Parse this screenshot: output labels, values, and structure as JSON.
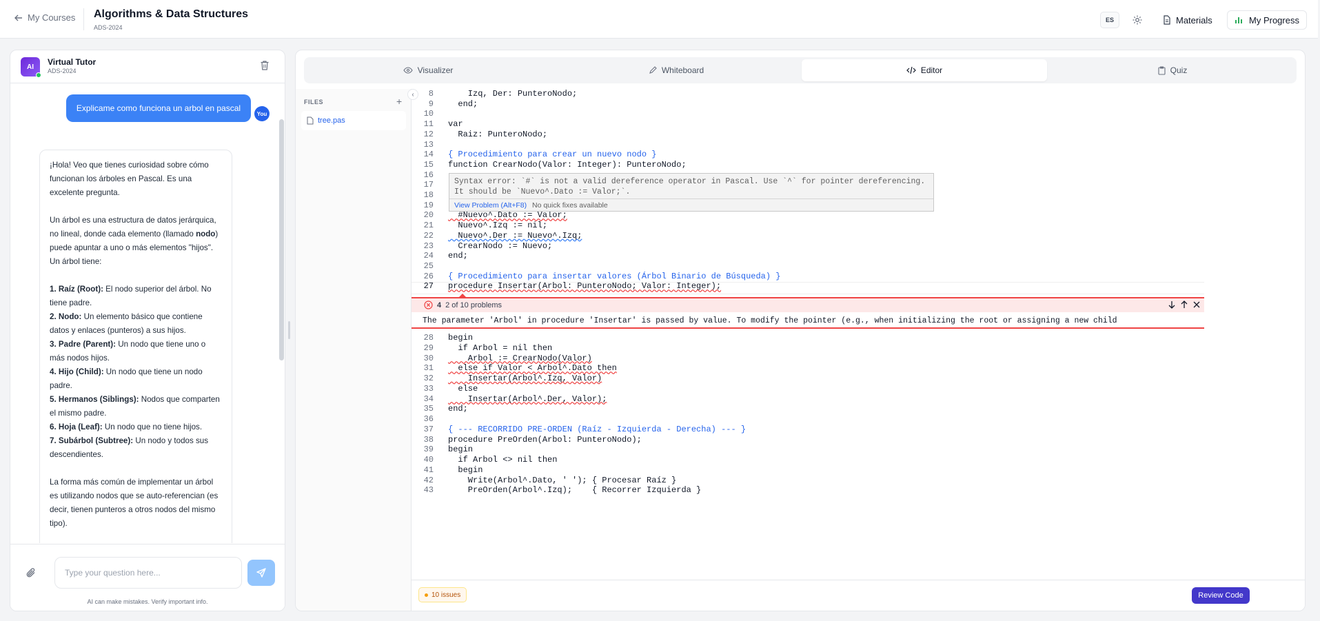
{
  "header": {
    "back_label": "My Courses",
    "title": "Algorithms & Data Structures",
    "code": "ADS-2024",
    "lang": "ES",
    "materials": "Materials",
    "progress": "My Progress"
  },
  "chat": {
    "tutor_name": "Virtual Tutor",
    "tutor_code": "ADS-2024",
    "avatar": "AI",
    "you": "You",
    "user_message": "Explicame como funciona un arbol en pascal",
    "input_placeholder": "Type your question here...",
    "disclaimer": "AI can make mistakes. Verify important info.",
    "ai_response": {
      "p1": "¡Hola! Veo que tienes curiosidad sobre cómo funcionan los árboles en Pascal. Es una excelente pregunta.",
      "p2a": "Un árbol es una estructura de datos jerárquica, no lineal, donde cada elemento (llamado ",
      "p2b": "nodo",
      "p2c": ") puede apuntar a uno o más elementos \"hijos\". Un árbol tiene:",
      "items": [
        {
          "term": "1. Raíz (Root):",
          "desc": " El nodo superior del árbol. No tiene padre."
        },
        {
          "term": "2. Nodo:",
          "desc": " Un elemento básico que contiene datos y enlaces (punteros) a sus hijos."
        },
        {
          "term": "3. Padre (Parent):",
          "desc": " Un nodo que tiene uno o más nodos hijos."
        },
        {
          "term": "4. Hijo (Child):",
          "desc": " Un nodo que tiene un nodo padre."
        },
        {
          "term": "5. Hermanos (Siblings):",
          "desc": " Nodos que comparten el mismo padre."
        },
        {
          "term": "6. Hoja (Leaf):",
          "desc": " Un nodo que no tiene hijos."
        },
        {
          "term": "7. Subárbol (Subtree):",
          "desc": " Un nodo y todos sus descendientes."
        }
      ],
      "p3": "La forma más común de implementar un árbol es utilizando nodos que se auto-referencian (es decir, tienen punteros a otros nodos del mismo tipo)."
    }
  },
  "tabs": [
    {
      "label": "Visualizer",
      "icon": "eye-icon"
    },
    {
      "label": "Whiteboard",
      "icon": "pen-icon"
    },
    {
      "label": "Editor",
      "icon": "code-icon"
    },
    {
      "label": "Quiz",
      "icon": "clipboard-icon"
    }
  ],
  "files": {
    "header": "FILES",
    "add": "+",
    "items": [
      "tree.pas"
    ]
  },
  "editor": {
    "lines": [
      {
        "n": "8",
        "t": "    Izq, Der: PunteroNodo;"
      },
      {
        "n": "9",
        "t": "  end;"
      },
      {
        "n": "10",
        "t": ""
      },
      {
        "n": "11",
        "t": "var"
      },
      {
        "n": "12",
        "t": "  Raiz: PunteroNodo;"
      },
      {
        "n": "13",
        "t": ""
      },
      {
        "n": "14",
        "t": "{ Procedimiento para crear un nuevo nodo }"
      },
      {
        "n": "15",
        "t": "function CrearNodo(Valor: Integer): PunteroNodo;"
      },
      {
        "n": "16",
        "t": ""
      },
      {
        "n": "17",
        "t": ""
      },
      {
        "n": "18",
        "t": ""
      },
      {
        "n": "19",
        "t": ""
      },
      {
        "n": "20",
        "t": "  #Nuevo^.Dato := Valor;"
      },
      {
        "n": "21",
        "t": "  Nuevo^.Izq := nil;"
      },
      {
        "n": "22",
        "t": "  Nuevo^.Der := Nuevo^.Izq;"
      },
      {
        "n": "23",
        "t": "  CrearNodo := Nuevo;"
      },
      {
        "n": "24",
        "t": "end;"
      },
      {
        "n": "25",
        "t": ""
      },
      {
        "n": "26",
        "t": "{ Procedimiento para insertar valores (Árbol Binario de Búsqueda) }"
      },
      {
        "n": "27",
        "t": "procedure Insertar(Arbol: PunteroNodo; Valor: Integer);"
      }
    ],
    "lines_after": [
      {
        "n": "28",
        "t": "begin"
      },
      {
        "n": "29",
        "t": "  if Arbol = nil then"
      },
      {
        "n": "30",
        "t": "    Arbol := CrearNodo(Valor)"
      },
      {
        "n": "31",
        "t": "  else if Valor < Arbol^.Dato then"
      },
      {
        "n": "32",
        "t": "    Insertar(Arbol^.Izq, Valor)"
      },
      {
        "n": "33",
        "t": "  else"
      },
      {
        "n": "34",
        "t": "    Insertar(Arbol^.Der, Valor);"
      },
      {
        "n": "35",
        "t": "end;"
      },
      {
        "n": "36",
        "t": ""
      },
      {
        "n": "37",
        "t": "{ --- RECORRIDO PRE-ORDEN (Raíz - Izquierda - Derecha) --- }"
      },
      {
        "n": "38",
        "t": "procedure PreOrden(Arbol: PunteroNodo);"
      },
      {
        "n": "39",
        "t": "begin"
      },
      {
        "n": "40",
        "t": "  if Arbol <> nil then"
      },
      {
        "n": "41",
        "t": "  begin"
      },
      {
        "n": "42",
        "t": "    Write(Arbol^.Dato, ' '); { Procesar Raíz }"
      },
      {
        "n": "43",
        "t": "    PreOrden(Arbol^.Izq);    { Recorrer Izquierda }"
      }
    ],
    "hover": {
      "message": "Syntax error: `#` is not a valid dereference operator in Pascal. Use `^` for pointer dereferencing. It should be `Nuevo^.Dato := Valor;`.",
      "view_problem": "View Problem (Alt+F8)",
      "no_fixes": "No quick fixes available"
    },
    "peek": {
      "count": "4",
      "position": "2 of 10 problems",
      "message": "The parameter 'Arbol' in procedure 'Insertar' is passed by value. To modify the pointer (e.g., when initializing the root or assigning a new child"
    }
  },
  "footer": {
    "issues": "10 issues",
    "review": "Review Code"
  },
  "colors": {
    "accent": "#3b82f6",
    "review": "#4338ca",
    "error": "#ef4444"
  }
}
